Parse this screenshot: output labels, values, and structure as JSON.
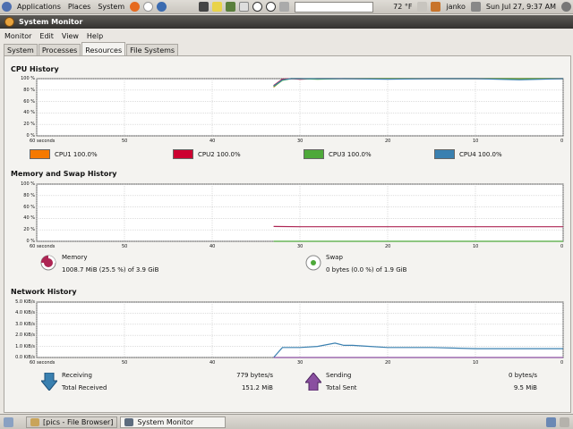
{
  "top_panel": {
    "menus": [
      "Applications",
      "Places",
      "System"
    ],
    "temperature": "72 °F",
    "user": "janko",
    "clock": "Sun Jul 27,  9:37 AM"
  },
  "window": {
    "title": "System Monitor"
  },
  "menubar": [
    "Monitor",
    "Edit",
    "View",
    "Help"
  ],
  "tabs": [
    "System",
    "Processes",
    "Resources",
    "File Systems"
  ],
  "active_tab": "Resources",
  "cpu": {
    "title": "CPU History",
    "y_ticks": [
      "100 %",
      "80 %",
      "60 %",
      "40 %",
      "20 %",
      "0 %"
    ],
    "x_ticks": [
      "60 seconds",
      "50",
      "40",
      "30",
      "20",
      "10",
      "0"
    ],
    "cores": [
      {
        "label": "CPU1",
        "value": "100.0%",
        "color": "#f57900"
      },
      {
        "label": "CPU2",
        "value": "100.0%",
        "color": "#cc0030"
      },
      {
        "label": "CPU3",
        "value": "100.0%",
        "color": "#4ea93a"
      },
      {
        "label": "CPU4",
        "value": "100.0%",
        "color": "#3a80b0"
      }
    ]
  },
  "mem": {
    "title": "Memory and Swap History",
    "y_ticks": [
      "100 %",
      "80 %",
      "60 %",
      "40 %",
      "20 %",
      "0 %"
    ],
    "x_ticks": [
      "60 seconds",
      "50",
      "40",
      "30",
      "20",
      "10",
      "0"
    ],
    "memory": {
      "label": "Memory",
      "detail": "1008.7 MiB (25.5 %) of 3.9 GiB",
      "color": "#ad2553"
    },
    "swap": {
      "label": "Swap",
      "detail": "0 bytes (0.0 %) of 1.9 GiB",
      "color": "#4ea93a"
    }
  },
  "net": {
    "title": "Network History",
    "y_ticks": [
      "5.0 KiB/s",
      "4.0 KiB/s",
      "3.0 KiB/s",
      "2.0 KiB/s",
      "1.0 KiB/s",
      "0.0 KiB/s"
    ],
    "x_ticks": [
      "60 seconds",
      "50",
      "40",
      "30",
      "20",
      "10",
      "0"
    ],
    "receiving_label": "Receiving",
    "receiving_value": "779 bytes/s",
    "total_received_label": "Total Received",
    "total_received_value": "151.2 MiB",
    "sending_label": "Sending",
    "sending_value": "0 bytes/s",
    "total_sent_label": "Total Sent",
    "total_sent_value": "9.5 MiB",
    "receive_color": "#3a80b0",
    "send_color": "#8a4fa0"
  },
  "taskbar": [
    {
      "label": "[pics - File Browser]",
      "active": false
    },
    {
      "label": "System Monitor",
      "active": true
    }
  ],
  "chart_data": [
    {
      "type": "line",
      "title": "CPU History",
      "x": [
        33,
        32,
        31,
        30,
        28,
        25,
        20,
        15,
        10,
        5,
        0
      ],
      "series": [
        {
          "name": "CPU1",
          "values": [
            85,
            98,
            100,
            100,
            100,
            100,
            100,
            100,
            100,
            100,
            100
          ]
        },
        {
          "name": "CPU2",
          "values": [
            88,
            99,
            100,
            99,
            100,
            100,
            100,
            100,
            100,
            100,
            100
          ]
        },
        {
          "name": "CPU3",
          "values": [
            86,
            97,
            100,
            100,
            99,
            100,
            100,
            100,
            100,
            100,
            100
          ]
        },
        {
          "name": "CPU4",
          "values": [
            87,
            98,
            100,
            100,
            100,
            100,
            99,
            100,
            100,
            98,
            100
          ]
        }
      ],
      "ylim": [
        0,
        100
      ],
      "xlim": [
        60,
        0
      ],
      "grid": true
    },
    {
      "type": "line",
      "title": "Memory and Swap History",
      "x": [
        33,
        30,
        20,
        10,
        0
      ],
      "series": [
        {
          "name": "Memory",
          "values": [
            26,
            25.5,
            25.5,
            25.5,
            25.5
          ]
        },
        {
          "name": "Swap",
          "values": [
            0,
            0,
            0,
            0,
            0
          ]
        }
      ],
      "ylim": [
        0,
        100
      ],
      "xlim": [
        60,
        0
      ],
      "grid": true
    },
    {
      "type": "line",
      "title": "Network History",
      "x": [
        33,
        32,
        30,
        28,
        26,
        25,
        24,
        22,
        20,
        15,
        10,
        5,
        0
      ],
      "series": [
        {
          "name": "Receiving",
          "values": [
            0,
            0.9,
            0.9,
            1.0,
            1.3,
            1.1,
            1.1,
            1.0,
            0.9,
            0.9,
            0.8,
            0.8,
            0.8
          ]
        },
        {
          "name": "Sending",
          "values": [
            0,
            0,
            0,
            0,
            0,
            0,
            0,
            0,
            0,
            0,
            0,
            0,
            0
          ]
        }
      ],
      "ylim": [
        0,
        5
      ],
      "xlim": [
        60,
        0
      ],
      "grid": true
    }
  ]
}
